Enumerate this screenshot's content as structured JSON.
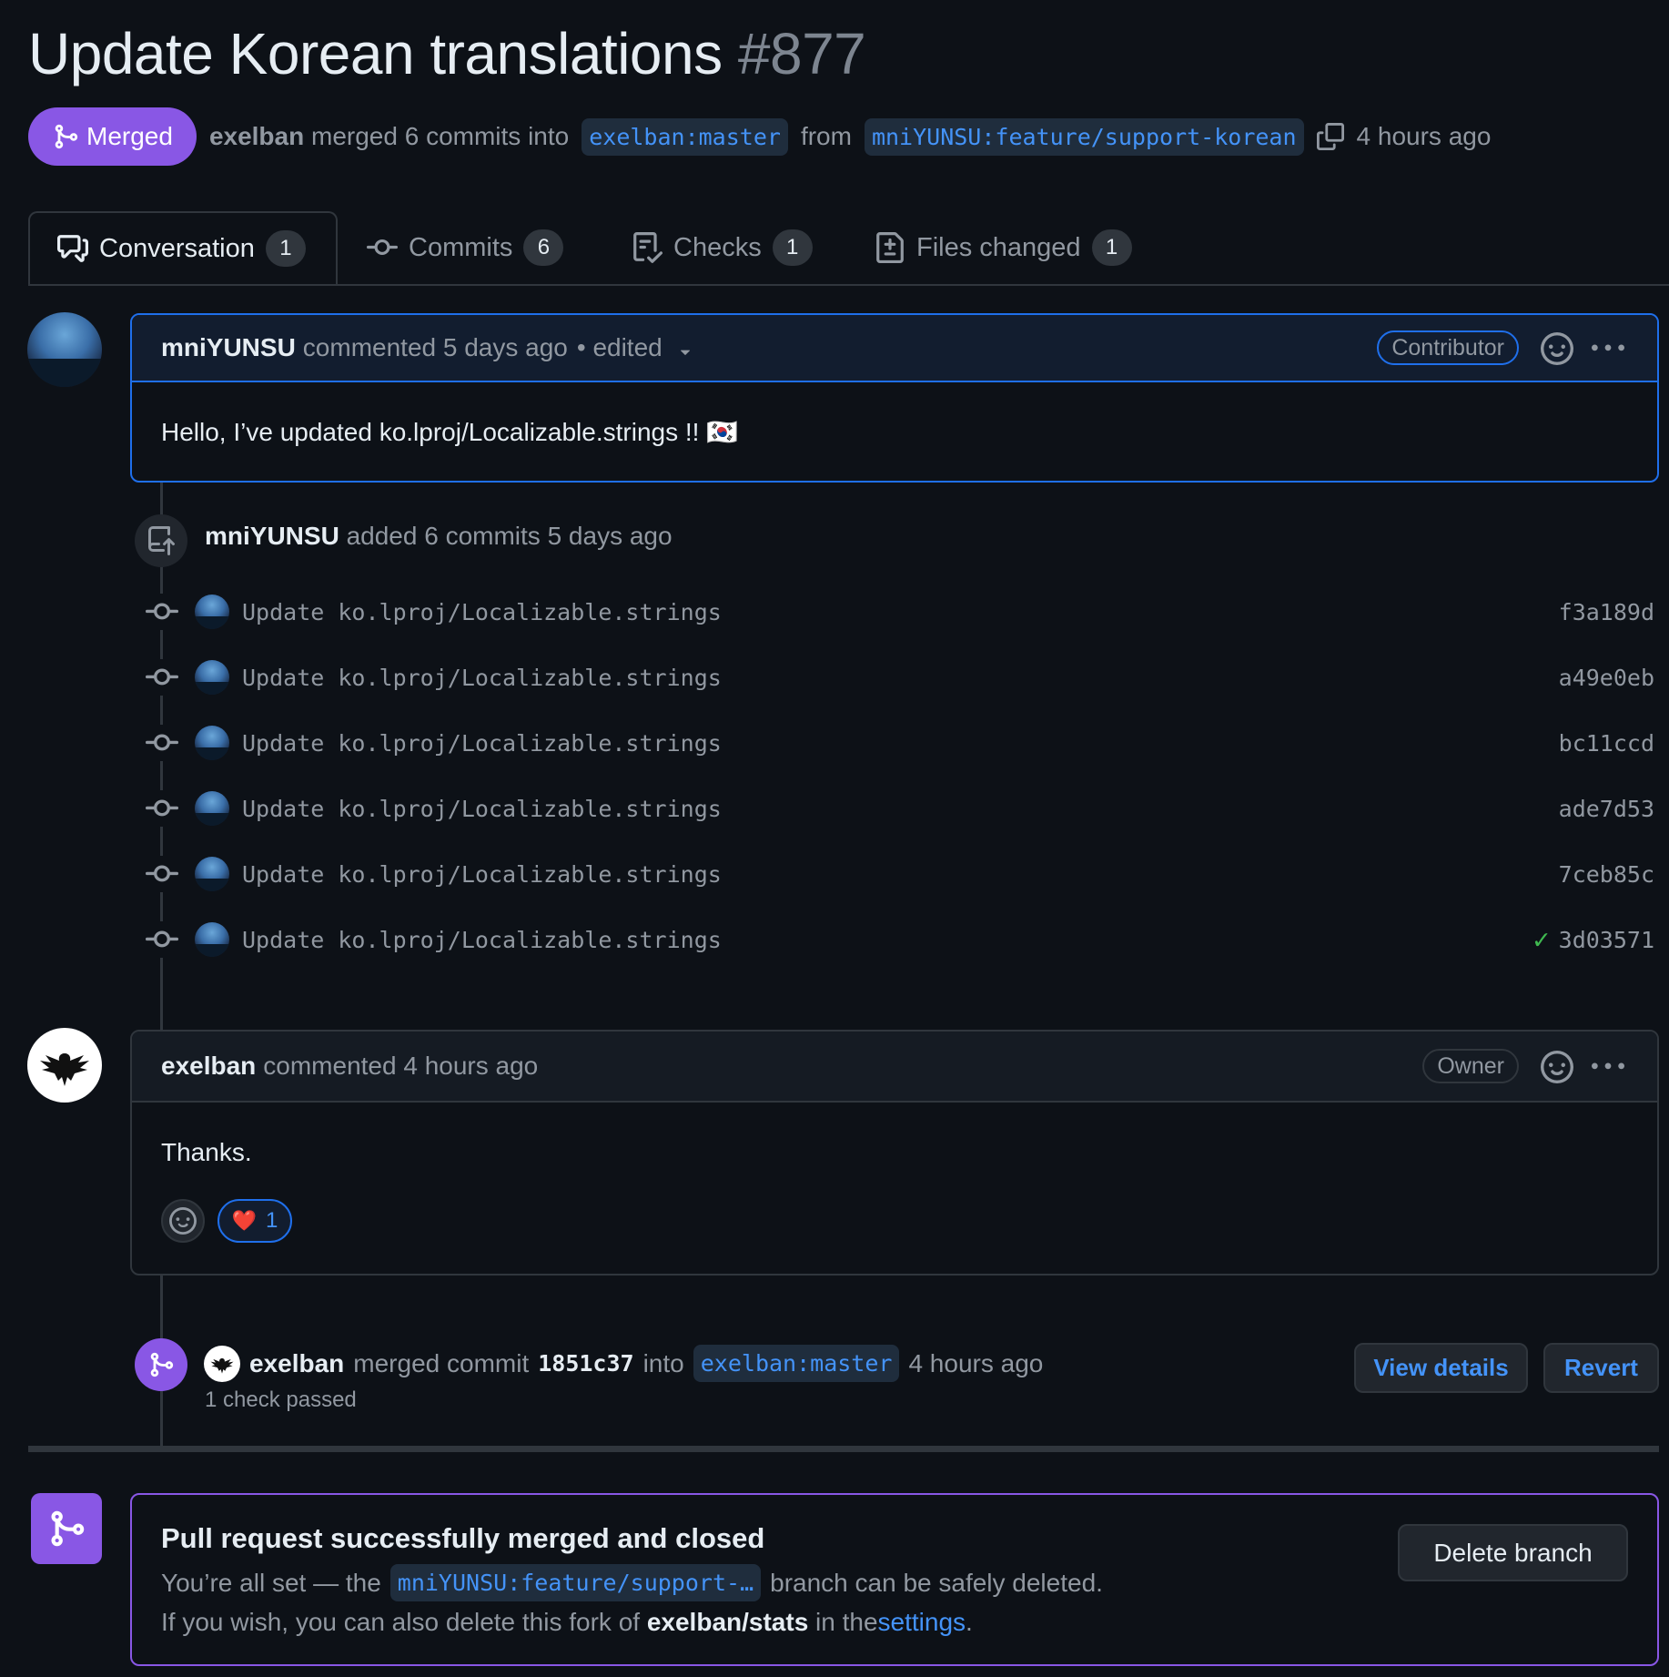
{
  "pr": {
    "title": "Update Korean translations",
    "number": "#877",
    "status": "Merged",
    "merger": "exelban",
    "merge_text": "merged 6 commits into",
    "base_branch": "exelban:master",
    "from_text": "from",
    "head_branch": "mniYUNSU:feature/support-korean",
    "time": "4 hours ago"
  },
  "tabs": [
    {
      "label": "Conversation",
      "count": "1"
    },
    {
      "label": "Commits",
      "count": "6"
    },
    {
      "label": "Checks",
      "count": "1"
    },
    {
      "label": "Files changed",
      "count": "1"
    }
  ],
  "comment1": {
    "author": "mniYUNSU",
    "meta": "commented 5 days ago",
    "edited": "• edited",
    "role": "Contributor",
    "body": "Hello, I’ve updated ko.lproj/Localizable.strings !! 🇰🇷"
  },
  "commits_event": {
    "author": "mniYUNSU",
    "text": "added 6 commits 5 days ago",
    "commits": [
      {
        "message": "Update ko.lproj/Localizable.strings",
        "sha": "f3a189d",
        "check": ""
      },
      {
        "message": "Update ko.lproj/Localizable.strings",
        "sha": "a49e0eb",
        "check": ""
      },
      {
        "message": "Update ko.lproj/Localizable.strings",
        "sha": "bc11ccd",
        "check": ""
      },
      {
        "message": "Update ko.lproj/Localizable.strings",
        "sha": "ade7d53",
        "check": ""
      },
      {
        "message": "Update ko.lproj/Localizable.strings",
        "sha": "7ceb85c",
        "check": ""
      },
      {
        "message": "Update ko.lproj/Localizable.strings",
        "sha": "3d03571",
        "check": "✓"
      }
    ]
  },
  "comment2": {
    "author": "exelban",
    "meta": "commented 4 hours ago",
    "role": "Owner",
    "body": "Thanks.",
    "reaction_emoji": "❤️",
    "reaction_count": "1"
  },
  "merge_event": {
    "author": "exelban",
    "text1": "merged commit",
    "commit": "1851c37",
    "text2": "into",
    "branch": "exelban:master",
    "time": "4 hours ago",
    "checks": "1 check passed",
    "view_details": "View details",
    "revert": "Revert"
  },
  "merged_box": {
    "title": "Pull request successfully merged and closed",
    "line1_pre": "You’re all set — the",
    "branch": "mniYUNSU:feature/support-…",
    "line1_post": "branch can be safely deleted.",
    "line2_pre": "If you wish, you can also delete this fork of",
    "repo": "exelban/stats",
    "line2_mid": "in the",
    "settings_link": "settings",
    "line2_post": ".",
    "delete_button": "Delete branch"
  },
  "colors": {
    "merged_purple": "#8957e5",
    "link_blue": "#4493f8",
    "success_green": "#3fb950",
    "background": "#0d1117",
    "border": "#30363d"
  },
  "icons": {
    "merge": "git-merge-icon",
    "copy": "copy-icon",
    "conversation": "comment-discussion-icon",
    "commits": "git-commit-icon",
    "checks": "checklist-icon",
    "files": "file-diff-icon",
    "smiley": "smiley-icon",
    "kebab": "kebab-horizontal-icon",
    "push": "repo-push-icon",
    "check": "check-icon"
  }
}
